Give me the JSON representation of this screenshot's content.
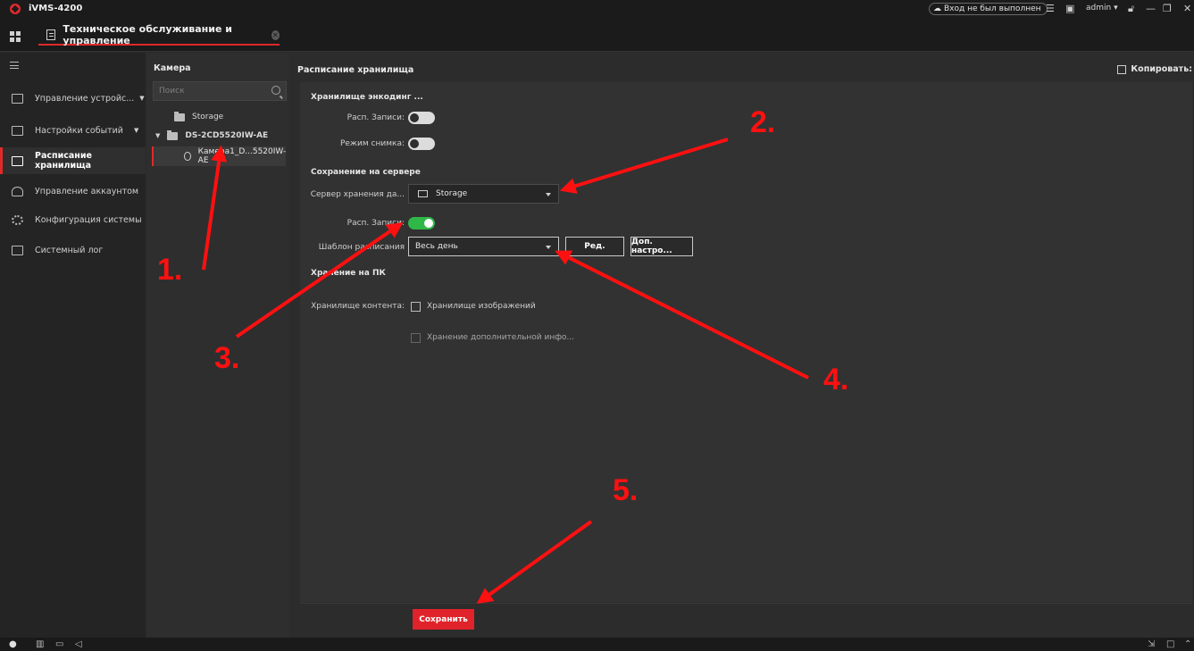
{
  "app": {
    "title": "iVMS-4200"
  },
  "titlebar": {
    "login_status": "Вход не был выполнен",
    "user": "admin",
    "icons": [
      "cloud-icon",
      "list-icon",
      "image-icon",
      "lock-icon",
      "minimize-icon",
      "restore-icon",
      "close-icon"
    ]
  },
  "tab": {
    "label": "Техническое обслуживание и управление"
  },
  "nav": {
    "items": [
      {
        "label": "Управление устройс...",
        "icon": "device-icon",
        "has_arrow": true
      },
      {
        "label": "Настройки событий",
        "icon": "event-icon",
        "has_arrow": true
      },
      {
        "label": "Расписание хранилища",
        "icon": "storage-icon",
        "active": true
      },
      {
        "label": "Управление аккаунтом",
        "icon": "person-icon"
      },
      {
        "label": "Конфигурация системы",
        "icon": "gear-icon"
      },
      {
        "label": "Системный лог",
        "icon": "log-icon"
      }
    ]
  },
  "camera_panel": {
    "header": "Камера",
    "search_placeholder": "Поиск",
    "tree": {
      "storage": "Storage",
      "device": "DS-2CD5520IW-AE",
      "camera": "Камера1_D...5520IW-AE"
    }
  },
  "main": {
    "title": "Расписание хранилища",
    "copy_label": "Копировать:",
    "encoding": {
      "section": "Хранилище энкодинг ...",
      "record_label": "Расп. Записи:",
      "record_on": false,
      "snapshot_label": "Режим снимка:",
      "snapshot_on": false
    },
    "server": {
      "section": "Сохранение на сервере",
      "storage_server_label": "Сервер хранения да...",
      "storage_server_value": "Storage",
      "record_label": "Расп. Записи:",
      "record_on": true,
      "template_label": "Шаблон расписания",
      "template_value": "Весь день",
      "edit_button": "Ред.",
      "advanced_button": "Доп. настро..."
    },
    "pc": {
      "section": "Хранение на ПК",
      "content_label": "Хранилище контента:",
      "image_storage": "Хранилище изображений",
      "extra_storage": "Хранение дополнительной инфо..."
    },
    "save_button": "Сохранить"
  },
  "annotations": {
    "color": "#ff1010",
    "labels": [
      "1.",
      "2.",
      "3.",
      "4.",
      "5."
    ]
  },
  "colors": {
    "accent": "#e0232a",
    "toggle_on": "#2fb848"
  }
}
